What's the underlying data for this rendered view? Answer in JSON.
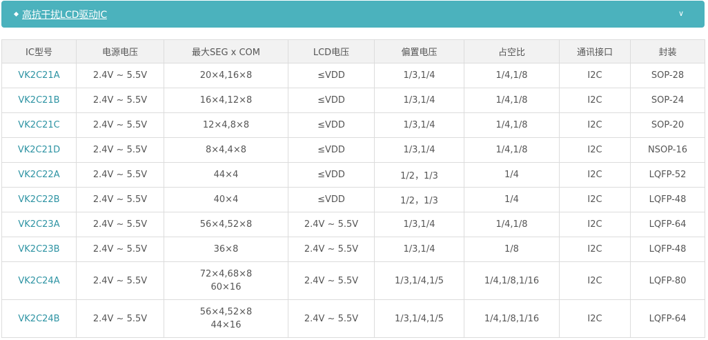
{
  "header": {
    "title": "高抗干扰LCD驱动IC",
    "chevron_icon": "chevron-down-icon",
    "color": "#4bb2bd"
  },
  "table": {
    "columns": [
      "IC型号",
      "电源电压",
      "最大SEG x COM",
      "LCD电压",
      "偏置电压",
      "占空比",
      "通讯接口",
      "封装"
    ],
    "rows": [
      {
        "model": "VK2C21A",
        "supply": "2.4V ~ 5.5V",
        "segcom": [
          "20×4,16×8"
        ],
        "lcd_voltage": "≤VDD",
        "bias": "1/3,1/4",
        "duty": "1/4,1/8",
        "interface": "I2C",
        "package": "SOP-28"
      },
      {
        "model": "VK2C21B",
        "supply": "2.4V ~ 5.5V",
        "segcom": [
          "16×4,12×8"
        ],
        "lcd_voltage": "≤VDD",
        "bias": "1/3,1/4",
        "duty": "1/4,1/8",
        "interface": "I2C",
        "package": "SOP-24"
      },
      {
        "model": "VK2C21C",
        "supply": "2.4V ~ 5.5V",
        "segcom": [
          "12×4,8×8"
        ],
        "lcd_voltage": "≤VDD",
        "bias": "1/3,1/4",
        "duty": "1/4,1/8",
        "interface": "I2C",
        "package": "SOP-20"
      },
      {
        "model": "VK2C21D",
        "supply": "2.4V ~ 5.5V",
        "segcom": [
          "8×4,4×8"
        ],
        "lcd_voltage": "≤VDD",
        "bias": "1/3,1/4",
        "duty": "1/4,1/8",
        "interface": "I2C",
        "package": "NSOP-16"
      },
      {
        "model": "VK2C22A",
        "supply": "2.4V ~ 5.5V",
        "segcom": [
          "44×4"
        ],
        "lcd_voltage": "≤VDD",
        "bias": "1/2，1/3",
        "duty": "1/4",
        "interface": "I2C",
        "package": "LQFP-52"
      },
      {
        "model": "VK2C22B",
        "supply": "2.4V ~ 5.5V",
        "segcom": [
          "40×4"
        ],
        "lcd_voltage": "≤VDD",
        "bias": "1/2，1/3",
        "duty": "1/4",
        "interface": "I2C",
        "package": "LQFP-48"
      },
      {
        "model": "VK2C23A",
        "supply": "2.4V ~ 5.5V",
        "segcom": [
          "56×4,52×8"
        ],
        "lcd_voltage": "2.4V ~ 5.5V",
        "bias": "1/3,1/4",
        "duty": "1/4,1/8",
        "interface": "I2C",
        "package": "LQFP-64"
      },
      {
        "model": "VK2C23B",
        "supply": "2.4V ~ 5.5V",
        "segcom": [
          "36×8"
        ],
        "lcd_voltage": "2.4V ~ 5.5V",
        "bias": "1/3,1/4",
        "duty": "1/8",
        "interface": "I2C",
        "package": "LQFP-48"
      },
      {
        "model": "VK2C24A",
        "supply": "2.4V ~ 5.5V",
        "segcom": [
          "72×4,68×8",
          "60×16"
        ],
        "lcd_voltage": "2.4V ~ 5.5V",
        "bias": "1/3,1/4,1/5",
        "duty": "1/4,1/8,1/16",
        "interface": "I2C",
        "package": "LQFP-80"
      },
      {
        "model": "VK2C24B",
        "supply": "2.4V ~ 5.5V",
        "segcom": [
          "56×4,52×8",
          "44×16"
        ],
        "lcd_voltage": "2.4V ~ 5.5V",
        "bias": "1/3,1/4,1/5",
        "duty": "1/4,1/8,1/16",
        "interface": "I2C",
        "package": "LQFP-64"
      }
    ]
  }
}
